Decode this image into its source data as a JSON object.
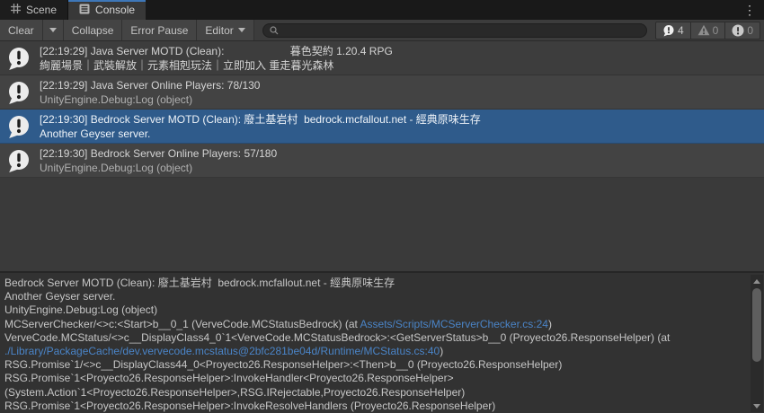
{
  "window": {
    "tabs": [
      {
        "label": "Scene"
      },
      {
        "label": "Console"
      }
    ],
    "menu_icon": "⋮"
  },
  "toolbar": {
    "clear": "Clear",
    "collapse": "Collapse",
    "error_pause": "Error Pause",
    "editor": "Editor",
    "search": {
      "value": "",
      "placeholder": ""
    },
    "counters": {
      "info": "4",
      "warning": "0",
      "error": "0"
    }
  },
  "console": {
    "entries": [
      {
        "line1": "[22:19:29] Java Server MOTD (Clean):                      暮色契約 1.20.4 RPG",
        "line2": "絢麗場景｜武裝解放｜元素相剋玩法｜立即加入 重走暮光森林",
        "selected": false
      },
      {
        "line1": "[22:19:29] Java Server Online Players: 78/130",
        "line2": "UnityEngine.Debug:Log (object)",
        "selected": false
      },
      {
        "line1": "[22:19:30] Bedrock Server MOTD (Clean): 廢土基岩村  bedrock.mcfallout.net - 經典原味生存",
        "line2": "Another Geyser server.",
        "selected": true
      },
      {
        "line1": "[22:19:30] Bedrock Server Online Players: 57/180",
        "line2": "UnityEngine.Debug:Log (object)",
        "selected": false
      }
    ]
  },
  "detail": {
    "lines": [
      {
        "pre": "Bedrock Server MOTD (Clean): 廢土基岩村  bedrock.mcfallout.net - 經典原味生存"
      },
      {
        "pre": "Another Geyser server."
      },
      {
        "pre": "UnityEngine.Debug:Log (object)"
      },
      {
        "pre": "MCServerChecker/<>c:<Start>b__0_1 (VerveCode.MCStatusBedrock) (at ",
        "link": "Assets/Scripts/MCServerChecker.cs:24",
        "post": ")"
      },
      {
        "pre": "VerveCode.MCStatus/<>c__DisplayClass4_0`1<VerveCode.MCStatusBedrock>:<GetServerStatus>b__0 (Proyecto26.ResponseHelper) (at "
      },
      {
        "link": "./Library/PackageCache/dev.vervecode.mcstatus@2bfc281be04d/Runtime/MCStatus.cs:40",
        "post": ")"
      },
      {
        "pre": "RSG.Promise`1/<>c__DisplayClass44_0<Proyecto26.ResponseHelper>:<Then>b__0 (Proyecto26.ResponseHelper)"
      },
      {
        "pre": "RSG.Promise`1<Proyecto26.ResponseHelper>:InvokeHandler<Proyecto26.ResponseHelper>"
      },
      {
        "pre": "(System.Action`1<Proyecto26.ResponseHelper>,RSG.IRejectable,Proyecto26.ResponseHelper)"
      },
      {
        "pre": "RSG.Promise`1<Proyecto26.ResponseHelper>:InvokeResolveHandlers (Proyecto26.ResponseHelper)"
      }
    ]
  },
  "colors": {
    "selection": "#2f5b8b",
    "tab_accent": "#3e77b8",
    "link": "#4a84c7"
  }
}
